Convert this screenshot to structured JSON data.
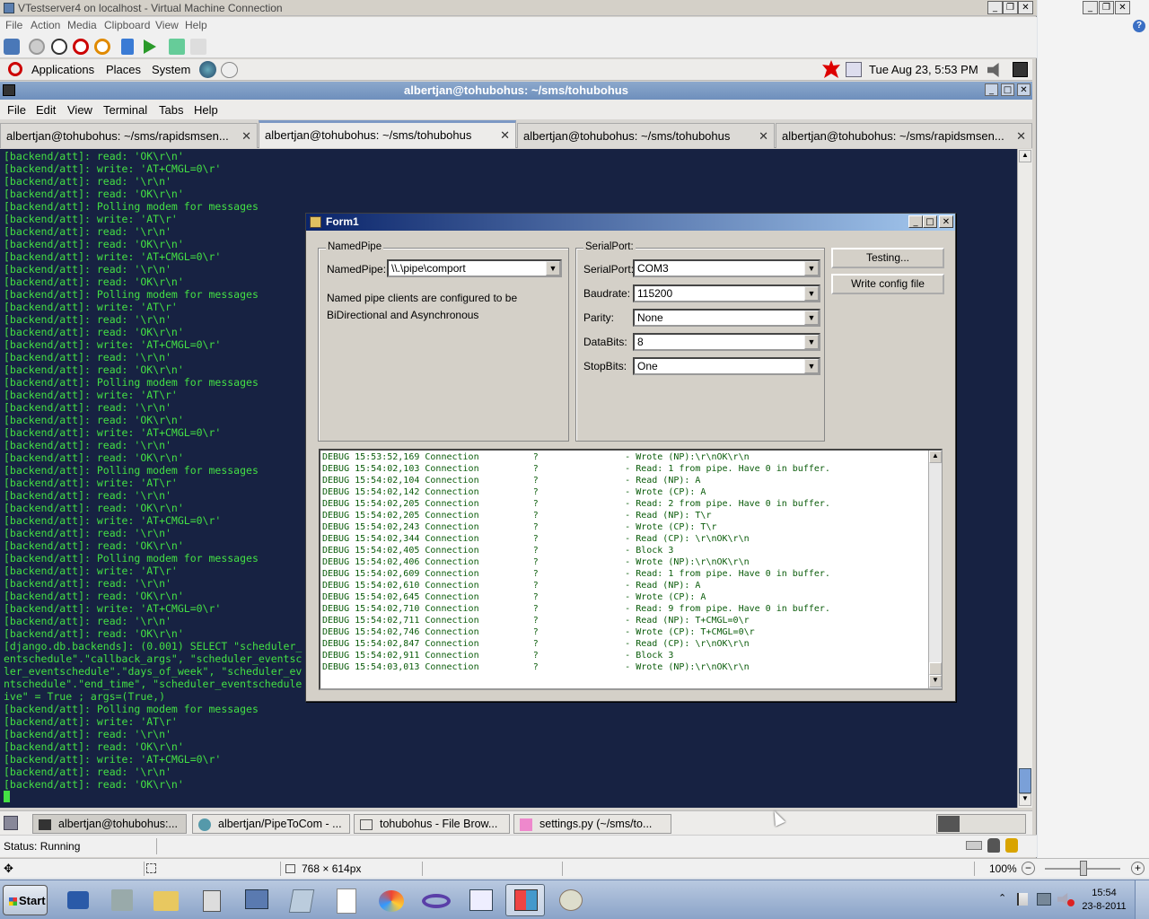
{
  "vm": {
    "title": "VTestserver4 on localhost - Virtual Machine Connection",
    "menu": [
      "File",
      "Action",
      "Media",
      "Clipboard",
      "View",
      "Help"
    ],
    "status": "Status: Running"
  },
  "gnome_panel": {
    "applications": "Applications",
    "places": "Places",
    "system": "System",
    "clock": "Tue Aug 23,  5:53 PM"
  },
  "terminal": {
    "title": "albertjan@tohubohus: ~/sms/tohubohus",
    "menu": [
      "File",
      "Edit",
      "View",
      "Terminal",
      "Tabs",
      "Help"
    ],
    "tabs": [
      "albertjan@tohubohus: ~/sms/rapidsmsen...",
      "albertjan@tohubohus: ~/sms/tohubohus",
      "albertjan@tohubohus: ~/sms/tohubohus",
      "albertjan@tohubohus: ~/sms/rapidsmsen..."
    ],
    "lines": [
      "[backend/att]: read: 'OK\\r\\n'",
      "[backend/att]: write: 'AT+CMGL=0\\r'",
      "[backend/att]: read: '\\r\\n'",
      "[backend/att]: read: 'OK\\r\\n'",
      "[backend/att]: Polling modem for messages",
      "[backend/att]: write: 'AT\\r'",
      "[backend/att]: read: '\\r\\n'",
      "[backend/att]: read: 'OK\\r\\n'",
      "[backend/att]: write: 'AT+CMGL=0\\r'",
      "[backend/att]: read: '\\r\\n'",
      "[backend/att]: read: 'OK\\r\\n'",
      "[backend/att]: Polling modem for messages",
      "[backend/att]: write: 'AT\\r'",
      "[backend/att]: read: '\\r\\n'",
      "[backend/att]: read: 'OK\\r\\n'",
      "[backend/att]: write: 'AT+CMGL=0\\r'",
      "[backend/att]: read: '\\r\\n'",
      "[backend/att]: read: 'OK\\r\\n'",
      "[backend/att]: Polling modem for messages",
      "[backend/att]: write: 'AT\\r'",
      "[backend/att]: read: '\\r\\n'",
      "[backend/att]: read: 'OK\\r\\n'",
      "[backend/att]: write: 'AT+CMGL=0\\r'",
      "[backend/att]: read: '\\r\\n'",
      "[backend/att]: read: 'OK\\r\\n'",
      "[backend/att]: Polling modem for messages",
      "[backend/att]: write: 'AT\\r'",
      "[backend/att]: read: '\\r\\n'",
      "[backend/att]: read: 'OK\\r\\n'",
      "[backend/att]: write: 'AT+CMGL=0\\r'",
      "[backend/att]: read: '\\r\\n'",
      "[backend/att]: read: 'OK\\r\\n'",
      "[backend/att]: Polling modem for messages",
      "[backend/att]: write: 'AT\\r'",
      "[backend/att]: read: '\\r\\n'",
      "[backend/att]: read: 'OK\\r\\n'",
      "[backend/att]: write: 'AT+CMGL=0\\r'",
      "[backend/att]: read: '\\r\\n'",
      "[backend/att]: read: 'OK\\r\\n'",
      "[django.db.backends]: (0.001) SELECT \"scheduler_                                                                                       eduler_ev",
      "entschedule\".\"callback_args\", \"scheduler_eventsc                                                                                      \", \"schedu",
      "ler_eventschedule\".\"days_of_week\", \"scheduler_ev                                                                                       duler_eve",
      "ntschedule\".\"end_time\", \"scheduler_eventschedule                                                                                      ule\".\"act",
      "ive\" = True ; args=(True,)",
      "[backend/att]: Polling modem for messages",
      "[backend/att]: write: 'AT\\r'",
      "[backend/att]: read: '\\r\\n'",
      "[backend/att]: read: 'OK\\r\\n'",
      "[backend/att]: write: 'AT+CMGL=0\\r'",
      "[backend/att]: read: '\\r\\n'",
      "[backend/att]: read: 'OK\\r\\n'"
    ]
  },
  "form1": {
    "title": "Form1",
    "namedpipe": {
      "group": "NamedPipe",
      "label": "NamedPipe:",
      "value": "\\\\.\\pipe\\comport",
      "note": "Named pipe clients are configured to be BiDirectional and Asynchronous"
    },
    "serialport": {
      "group": "SerialPort:",
      "fields": [
        {
          "label": "SerialPort:",
          "value": "COM3"
        },
        {
          "label": "Baudrate:",
          "value": "115200"
        },
        {
          "label": "Parity:",
          "value": "None"
        },
        {
          "label": "DataBits:",
          "value": "8"
        },
        {
          "label": "StopBits:",
          "value": "One"
        }
      ]
    },
    "buttons": {
      "testing": "Testing...",
      "write_config": "Write config file"
    },
    "log": [
      "DEBUG 15:53:52,169 Connection          ?                - Wrote (NP):\\r\\nOK\\r\\n",
      "DEBUG 15:54:02,103 Connection          ?                - Read: 1 from pipe. Have 0 in buffer.",
      "DEBUG 15:54:02,104 Connection          ?                - Read (NP): A",
      "DEBUG 15:54:02,142 Connection          ?                - Wrote (CP): A",
      "DEBUG 15:54:02,205 Connection          ?                - Read: 2 from pipe. Have 0 in buffer.",
      "DEBUG 15:54:02,205 Connection          ?                - Read (NP): T\\r",
      "DEBUG 15:54:02,243 Connection          ?                - Wrote (CP): T\\r",
      "DEBUG 15:54:02,344 Connection          ?                - Read (CP): \\r\\nOK\\r\\n",
      "DEBUG 15:54:02,405 Connection          ?                - Block 3",
      "DEBUG 15:54:02,406 Connection          ?                - Wrote (NP):\\r\\nOK\\r\\n",
      "DEBUG 15:54:02,609 Connection          ?                - Read: 1 from pipe. Have 0 in buffer.",
      "DEBUG 15:54:02,610 Connection          ?                - Read (NP): A",
      "DEBUG 15:54:02,645 Connection          ?                - Wrote (CP): A",
      "DEBUG 15:54:02,710 Connection          ?                - Read: 9 from pipe. Have 0 in buffer.",
      "DEBUG 15:54:02,711 Connection          ?                - Read (NP): T+CMGL=0\\r",
      "DEBUG 15:54:02,746 Connection          ?                - Wrote (CP): T+CMGL=0\\r",
      "DEBUG 15:54:02,847 Connection          ?                - Read (CP): \\r\\nOK\\r\\n",
      "DEBUG 15:54:02,911 Connection          ?                - Block 3",
      "DEBUG 15:54:03,013 Connection          ?                - Wrote (NP):\\r\\nOK\\r\\n"
    ]
  },
  "gnome_taskbar": [
    "albertjan@tohubohus:...",
    "albertjan/PipeToCom - ...",
    "tohubohus - File Brow...",
    "settings.py (~/sms/to..."
  ],
  "image_viewer": {
    "dimensions": "768 × 614px",
    "zoom": "100%"
  },
  "windows_taskbar": {
    "start": "Start",
    "time": "15:54",
    "date": "23-8-2011"
  }
}
